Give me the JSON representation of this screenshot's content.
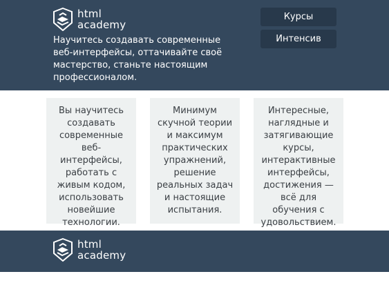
{
  "header": {
    "logo": {
      "line1": "html",
      "line2": "academy",
      "icon": "html-academy-shield-icon"
    },
    "tagline": "Научитесь создавать современные веб-интерфейсы, оттачивайте своё мастерство, станьте настоящим профессионалом.",
    "nav": [
      {
        "label": "Курсы"
      },
      {
        "label": "Интенсив"
      }
    ]
  },
  "features": [
    {
      "text": "Вы научитесь создавать современные веб-интерфейсы, работать с живым кодом, использовать новейшие технологии."
    },
    {
      "text": "Минимум скучной теории и максимум практических упражнений, решение реальных задач и настоящие испытания."
    },
    {
      "text": "Интересные, наглядные и затягивающие курсы, интерактивные интерфейсы, достижения — всё для обучения с удовольствием."
    }
  ],
  "footer": {
    "logo": {
      "line1": "html",
      "line2": "academy",
      "icon": "html-academy-shield-icon"
    }
  },
  "colors": {
    "header_bg": "#34485d",
    "nav_button_bg": "#28394b",
    "card_bg": "#eef1f1",
    "text_dark": "#3a3f44"
  }
}
